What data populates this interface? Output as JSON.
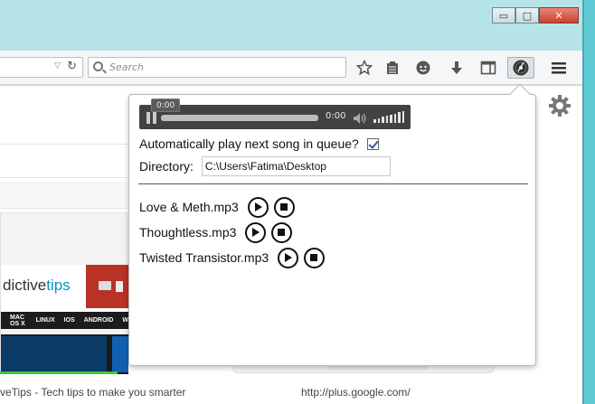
{
  "window": {
    "minimize_glyph": "▭",
    "maximize_glyph": "□",
    "close_glyph": "✕"
  },
  "toolbar": {
    "search_placeholder": "Search",
    "icons": [
      "bookmark-star-icon",
      "reading-list-icon",
      "pocket-icon",
      "download-icon",
      "sidebar-icon",
      "music-player-addon-icon",
      "menu-icon"
    ]
  },
  "page": {
    "logo": {
      "prefix": "dictive",
      "suffix": "tips"
    },
    "nav_items": [
      "MAC OS X",
      "LINUX",
      "IOS",
      "ANDROID",
      "W"
    ],
    "caption_left": "veTips - Tech tips to make you smarter",
    "caption_right": "http://plus.google.com/"
  },
  "player": {
    "tooltip": "0:00",
    "time": "0:00",
    "progress": 0,
    "volume_level": 1.0
  },
  "settings": {
    "autoplay_label": "Automatically play next song in queue?",
    "autoplay_checked": true,
    "directory_label": "Directory:",
    "directory_value": "C:\\Users\\Fatima\\Desktop"
  },
  "songs": [
    {
      "name": "Love & Meth.mp3"
    },
    {
      "name": "Thoughtless.mp3"
    },
    {
      "name": "Twisted Transistor.mp3"
    }
  ],
  "colors": {
    "window_frame": "#b6e3e8",
    "player_bg": "#424242",
    "logo_accent": "#0b8fc8",
    "logo_red": "#b83226"
  }
}
